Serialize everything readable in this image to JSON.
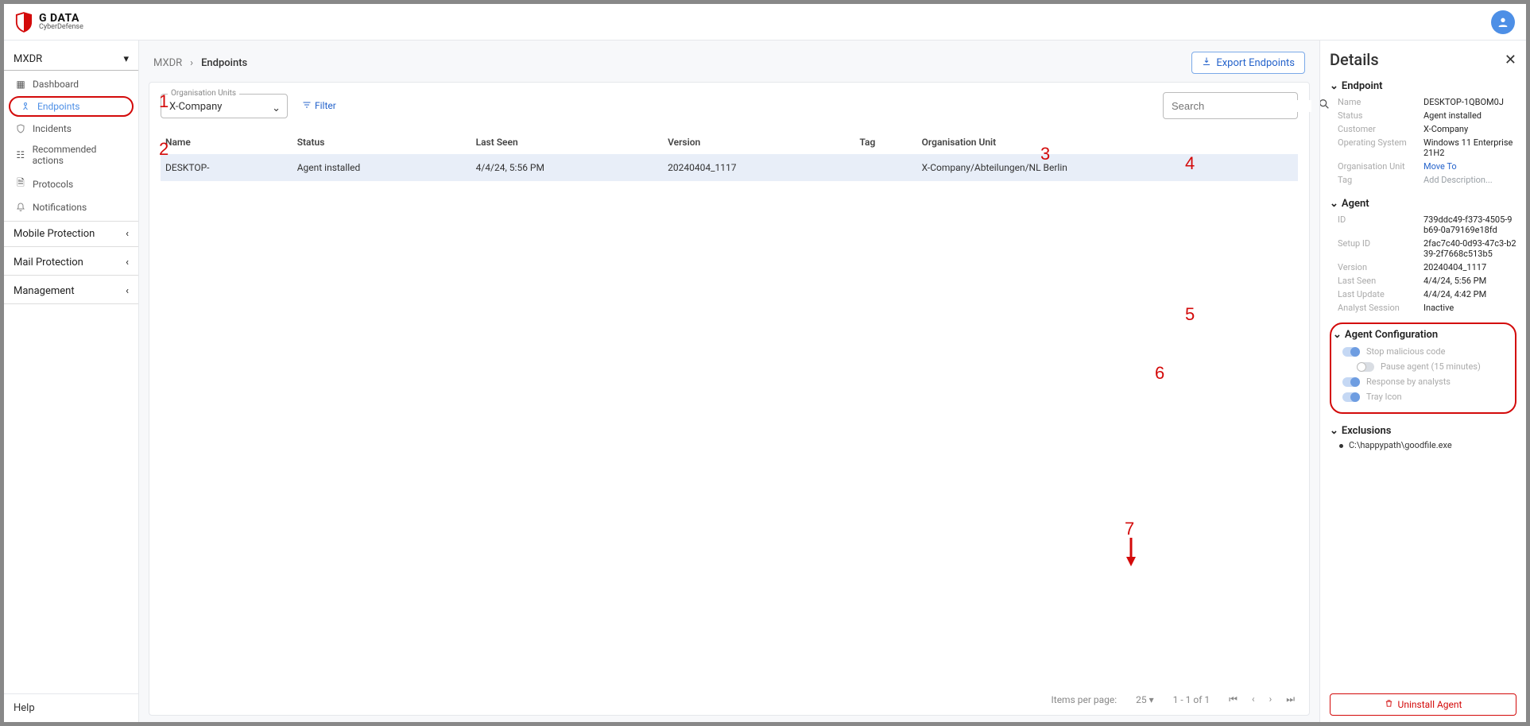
{
  "logo": {
    "line1": "G DATA",
    "line2": "CyberDefense"
  },
  "sidebar": {
    "section": "MXDR",
    "items": [
      {
        "label": "Dashboard"
      },
      {
        "label": "Endpoints"
      },
      {
        "label": "Incidents"
      },
      {
        "label": "Recommended actions"
      },
      {
        "label": "Protocols"
      },
      {
        "label": "Notifications"
      }
    ],
    "groups": [
      {
        "label": "Mobile Protection"
      },
      {
        "label": "Mail Protection"
      },
      {
        "label": "Management"
      }
    ],
    "help": "Help"
  },
  "breadcrumbs": {
    "root": "MXDR",
    "current": "Endpoints"
  },
  "export_button": "Export Endpoints",
  "filter": {
    "org_label": "Organisation Units",
    "org_value": "X-Company",
    "filter_label": "Filter",
    "search_placeholder": "Search"
  },
  "table": {
    "headers": [
      "Name",
      "Status",
      "Last Seen",
      "Version",
      "Tag",
      "Organisation Unit"
    ],
    "rows": [
      {
        "name": "DESKTOP-",
        "status": "Agent installed",
        "last_seen": "4/4/24, 5:56 PM",
        "version": "20240404_1117",
        "tag": "",
        "org": "X-Company/Abteilungen/NL Berlin"
      }
    ]
  },
  "pager": {
    "ipp_label": "Items per page:",
    "ipp_value": "25",
    "range": "1 - 1 of 1"
  },
  "details": {
    "title": "Details",
    "endpoint": {
      "heading": "Endpoint",
      "name": "DESKTOP-1QBOM0J",
      "status": "Agent installed",
      "customer": "X-Company",
      "os": "Windows 11 Enterprise 21H2",
      "org_unit_action": "Move To",
      "tag_action": "Add Description...",
      "labels": {
        "name": "Name",
        "status": "Status",
        "customer": "Customer",
        "os": "Operating System",
        "org": "Organisation Unit",
        "tag": "Tag"
      }
    },
    "agent": {
      "heading": "Agent",
      "id": "739ddc49-f373-4505-9b69-0a79169e18fd",
      "setup_id": "2fac7c40-0d93-47c3-b239-2f7668c513b5",
      "version": "20240404_1117",
      "last_seen": "4/4/24, 5:56 PM",
      "last_update": "4/4/24, 4:42 PM",
      "analyst_session": "Inactive",
      "labels": {
        "id": "ID",
        "setup": "Setup ID",
        "version": "Version",
        "last_seen": "Last Seen",
        "last_update": "Last Update",
        "analyst": "Analyst Session"
      }
    },
    "config": {
      "heading": "Agent Configuration",
      "stop": "Stop malicious code",
      "pause": "Pause agent (15 minutes)",
      "response": "Response by analysts",
      "tray": "Tray Icon"
    },
    "exclusions": {
      "heading": "Exclusions",
      "items": [
        "C:\\happypath\\goodfile.exe"
      ]
    },
    "uninstall": "Uninstall Agent"
  },
  "annotations": {
    "1": "1",
    "2": "2",
    "3": "3",
    "4": "4",
    "5": "5",
    "6": "6",
    "7": "7"
  }
}
